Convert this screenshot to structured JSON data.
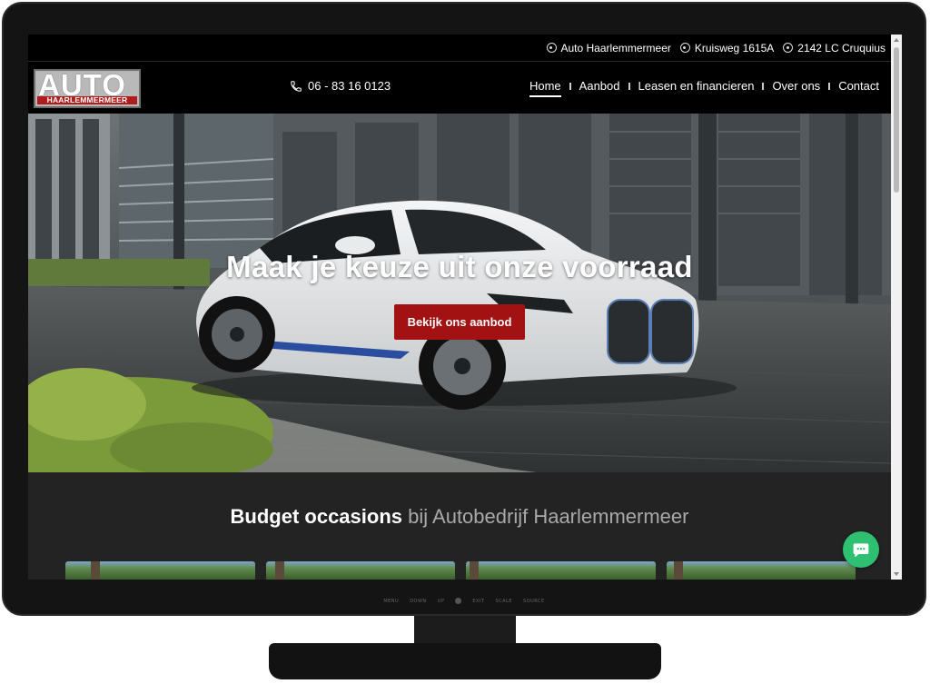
{
  "topbar": {
    "items": [
      {
        "icon": "location-pin-icon",
        "text": "Auto Haarlemmermeer"
      },
      {
        "icon": "location-pin-icon",
        "text": "Kruisweg 1615A"
      },
      {
        "icon": "location-pin-icon",
        "text": "2142 LC Cruquius"
      }
    ]
  },
  "logo": {
    "main": "AUTO",
    "sub": "HAARLEMMERMEER"
  },
  "phone": {
    "icon": "phone-icon",
    "number": "06 - 83 16 0123"
  },
  "nav": {
    "items": [
      {
        "label": "Home",
        "active": true
      },
      {
        "label": "Aanbod"
      },
      {
        "label": "Leasen en financieren"
      },
      {
        "label": "Over ons"
      },
      {
        "label": "Contact"
      }
    ]
  },
  "hero": {
    "title": "Maak je keuze uit onze voorraad",
    "button": "Bekijk ons aanbod"
  },
  "section": {
    "heading_strong": "Budget occasions",
    "heading_light": "bij Autobedrijf Haarlemmermeer"
  },
  "monitor": {
    "controls": [
      "MENU",
      "DOWN",
      "UP",
      "EXIT",
      "SCALE",
      "SOURCE"
    ]
  },
  "chat": {
    "icon": "chat-bubble-icon"
  },
  "colors": {
    "accent_red": "#a31212",
    "chat_green": "#2fbf71",
    "header_bg": "#000000",
    "section_bg": "#232323"
  }
}
